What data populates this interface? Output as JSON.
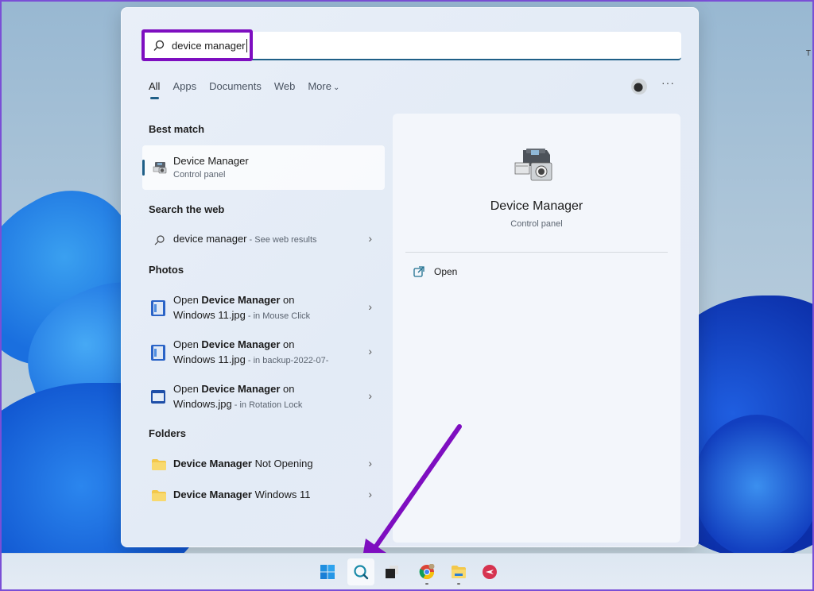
{
  "search": {
    "query": "device manager",
    "icon": "search-icon"
  },
  "tabs": [
    {
      "label": "All",
      "active": true
    },
    {
      "label": "Apps"
    },
    {
      "label": "Documents"
    },
    {
      "label": "Web"
    },
    {
      "label": "More"
    }
  ],
  "header_actions": {
    "avatar": "user-avatar",
    "more": "···"
  },
  "best_match": {
    "section_label": "Best match",
    "title": "Device Manager",
    "subtitle": "Control panel",
    "icon": "device-manager-icon"
  },
  "search_web": {
    "section_label": "Search the web",
    "query": "device manager",
    "suffix": " - See web results"
  },
  "photos": {
    "section_label": "Photos",
    "items": [
      {
        "prefix": "Open ",
        "bold": "Device Manager",
        "rest": " on",
        "line2": "Windows 11.jpg",
        "location": " - in Mouse Click"
      },
      {
        "prefix": "Open ",
        "bold": "Device Manager",
        "rest": " on",
        "line2": "Windows 11.jpg",
        "location": " - in backup-2022-07-"
      },
      {
        "prefix": "Open ",
        "bold": "Device Manager",
        "rest": " on",
        "line2": "Windows.jpg",
        "location": " - in Rotation Lock"
      }
    ]
  },
  "folders": {
    "section_label": "Folders",
    "items": [
      {
        "bold": "Device Manager",
        "rest": " Not Opening"
      },
      {
        "bold": "Device Manager",
        "rest": " Windows 11"
      }
    ]
  },
  "preview": {
    "title": "Device Manager",
    "subtitle": "Control panel",
    "actions": [
      {
        "label": "Open",
        "icon": "open-external-icon"
      }
    ]
  },
  "chevron": "›",
  "taskbar": {
    "items": [
      {
        "name": "start",
        "icon": "windows-logo-icon"
      },
      {
        "name": "search",
        "icon": "search-icon",
        "active": true
      },
      {
        "name": "task-view",
        "icon": "task-view-icon"
      },
      {
        "name": "chrome",
        "icon": "chrome-icon",
        "running": true
      },
      {
        "name": "file-explorer",
        "icon": "folder-icon",
        "running": true
      },
      {
        "name": "app",
        "icon": "app-icon"
      }
    ]
  },
  "colors": {
    "annotation": "#7e0ec0",
    "accent": "#1f5f87"
  }
}
